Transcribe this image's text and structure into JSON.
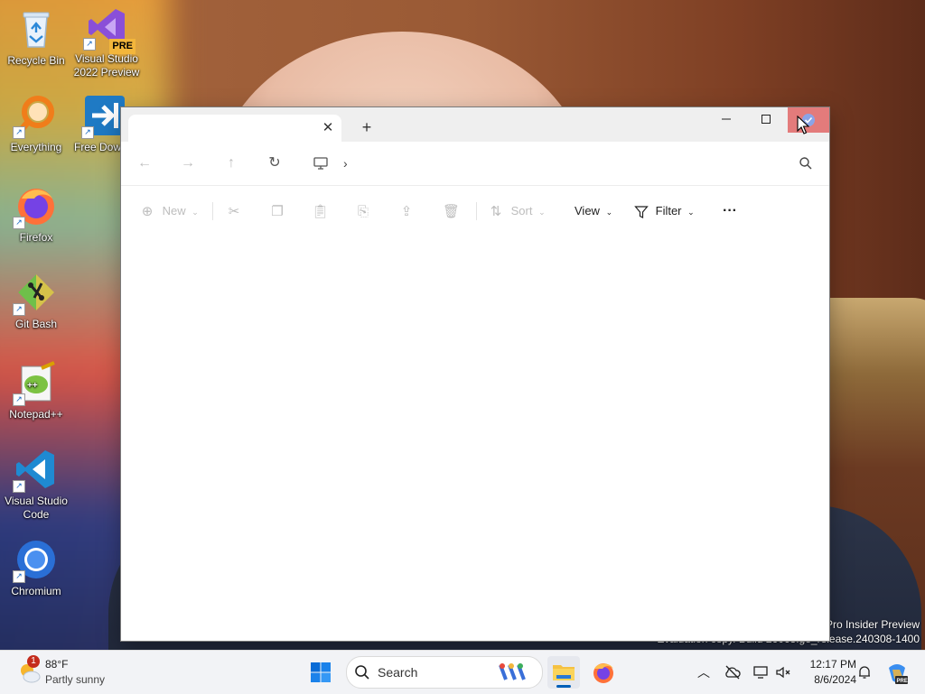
{
  "desktop": {
    "icons": [
      {
        "label": "Recycle Bin",
        "icon": "recycle-bin-icon"
      },
      {
        "label": "Visual Studio 2022 Preview",
        "icon": "visual-studio-icon",
        "badge": "PRE"
      },
      {
        "label": "Everything",
        "icon": "everything-search-icon"
      },
      {
        "label": "Free Downlo",
        "icon": "free-download-manager-icon"
      },
      {
        "label": "Firefox",
        "icon": "firefox-icon"
      },
      {
        "label": "Git Bash",
        "icon": "git-bash-icon"
      },
      {
        "label": "Notepad++",
        "icon": "notepad-plus-plus-icon"
      },
      {
        "label": "Visual Studio Code",
        "icon": "vscode-icon"
      },
      {
        "label": "Chromium",
        "icon": "chromium-icon"
      }
    ],
    "watermark": {
      "line1": "Pro Insider Preview",
      "line2": "Evaluation copy. Build 26063.ge_release.240308-1400"
    }
  },
  "explorer": {
    "tab": {
      "title": "",
      "close_glyph": "✕"
    },
    "new_tab_glyph": "+",
    "window_controls": {
      "minimize": "—",
      "maximize": "☐",
      "close": "✕"
    },
    "nav": {
      "back": "←",
      "forward": "→",
      "up": "↑",
      "refresh": "↻",
      "breadcrumb_chevron": "›"
    },
    "search": {
      "placeholder": ""
    },
    "commands": {
      "new": "New",
      "sort": "Sort",
      "view": "View",
      "filter": "Filter",
      "more": "···"
    }
  },
  "taskbar": {
    "weather": {
      "temp": "88°F",
      "condition": "Partly sunny",
      "badge": "1"
    },
    "search_label": "Search",
    "clock": {
      "time": "12:17 PM",
      "date": "8/6/2024"
    },
    "accent": "#005fb8"
  }
}
